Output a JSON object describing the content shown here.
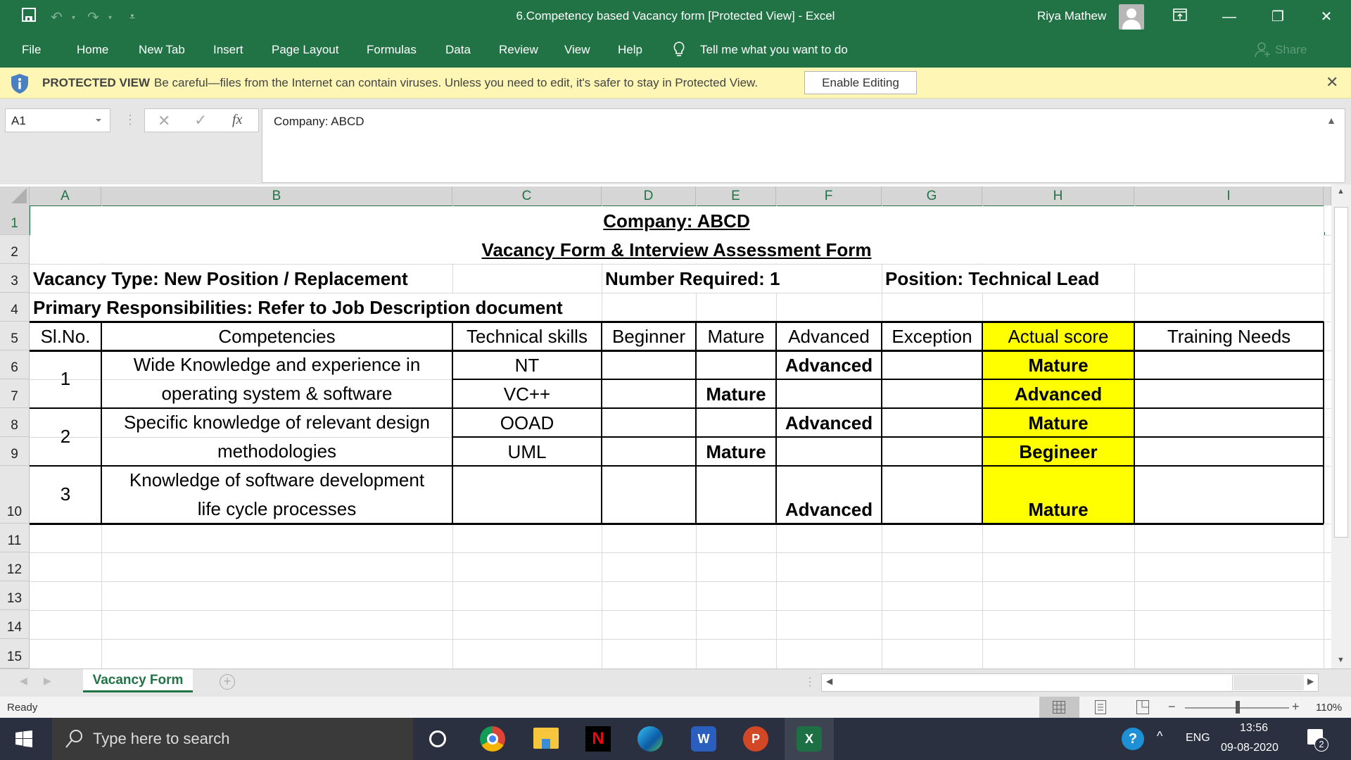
{
  "titlebar": {
    "title": "6.Competency based Vacancy form  [Protected View]  -  Excel",
    "user": "Riya Mathew",
    "icons": [
      "save-icon",
      "undo-icon",
      "redo-icon",
      "customize-qat-icon",
      "ribbon-display-icon",
      "minimize-icon",
      "restore-icon",
      "close-icon"
    ]
  },
  "ribbon": {
    "tabs": [
      "File",
      "Home",
      "New Tab",
      "Insert",
      "Page Layout",
      "Formulas",
      "Data",
      "Review",
      "View",
      "Help"
    ],
    "tell_me": "Tell me what you want to do",
    "share": "Share"
  },
  "protected_view": {
    "title": "PROTECTED VIEW",
    "message": "Be careful—files from the Internet can contain viruses. Unless you need to edit, it's safer to stay in Protected View.",
    "enable_button": "Enable Editing"
  },
  "formula_bar": {
    "name_box": "A1",
    "fx": "fx",
    "content": "Company: ABCD"
  },
  "columns": [
    "A",
    "B",
    "C",
    "D",
    "E",
    "F",
    "G",
    "H",
    "I"
  ],
  "rows": [
    "1",
    "2",
    "3",
    "4",
    "5",
    "6",
    "7",
    "8",
    "9",
    "10",
    "11",
    "12",
    "13",
    "14",
    "15"
  ],
  "sheet": {
    "company": "Company: ABCD",
    "form_title": "Vacancy Form & Interview Assessment Form",
    "vacancy_type": "Vacancy Type: New Position / Replacement",
    "number_required": "Number Required: 1",
    "position": "Position: Technical Lead",
    "responsibilities": "Primary Responsibilities: Refer to Job Description document",
    "table_headers": [
      "Sl.No.",
      "Competencies",
      "Technical skills",
      "Beginner",
      "Mature",
      "Advanced",
      "Exception",
      "Actual score",
      "Training Needs"
    ],
    "table_rows": [
      {
        "sl_no": "1",
        "competency": [
          "Wide Knowledge  and experience in",
          "operating system & software"
        ],
        "skills": [
          {
            "skill": "NT",
            "beginner": "",
            "mature": "",
            "advanced": "Advanced",
            "exception": "",
            "actual": "Mature",
            "training": ""
          },
          {
            "skill": "VC++",
            "beginner": "",
            "mature": "Mature",
            "advanced": "",
            "exception": "",
            "actual": "Advanced",
            "training": ""
          }
        ]
      },
      {
        "sl_no": "2",
        "competency": [
          "Specific knowledge of relevant design",
          "methodologies"
        ],
        "skills": [
          {
            "skill": "OOAD",
            "beginner": "",
            "mature": "",
            "advanced": "Advanced",
            "exception": "",
            "actual": "Mature",
            "training": ""
          },
          {
            "skill": "UML",
            "beginner": "",
            "mature": "Mature",
            "advanced": "",
            "exception": "",
            "actual": "Begineer",
            "training": ""
          }
        ]
      },
      {
        "sl_no": "3",
        "competency": [
          "Knowledge of software development",
          "life cycle processes"
        ],
        "skills": [
          {
            "skill": "",
            "beginner": "",
            "mature": "",
            "advanced": "Advanced",
            "exception": "",
            "actual": "Mature",
            "training": ""
          }
        ]
      }
    ],
    "highlight_color": "#ffff00"
  },
  "sheet_tabs": {
    "active": "Vacancy Form"
  },
  "status": {
    "text": "Ready",
    "zoom": "110%"
  },
  "taskbar": {
    "search_placeholder": "Type here to search",
    "apps": [
      "cortana",
      "chrome",
      "file-explorer",
      "netflix",
      "edge",
      "word",
      "powerpoint",
      "excel"
    ],
    "language": "ENG",
    "time": "13:56",
    "date": "09-08-2020",
    "notifications": "2"
  }
}
